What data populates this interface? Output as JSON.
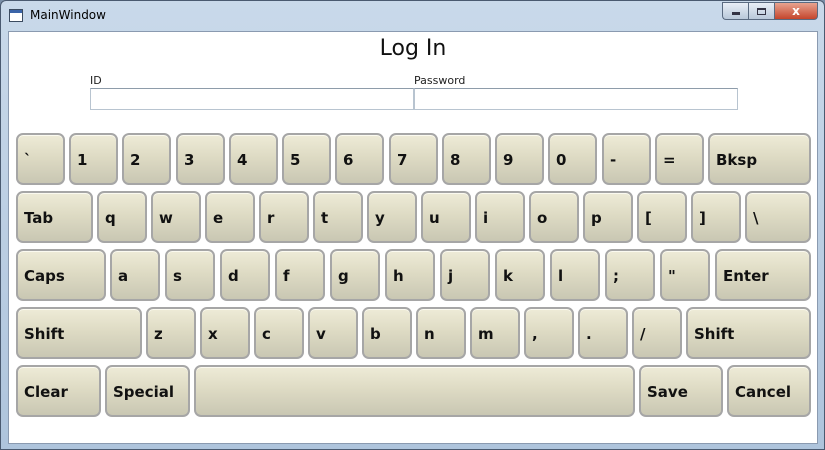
{
  "window": {
    "title": "MainWindow",
    "close_glyph": "x"
  },
  "heading": "Log In",
  "fields": {
    "id": {
      "label": "ID",
      "value": ""
    },
    "password": {
      "label": "Password",
      "value": ""
    }
  },
  "keyboard": {
    "row1": [
      "`",
      "1",
      "2",
      "3",
      "4",
      "5",
      "6",
      "7",
      "8",
      "9",
      "0",
      "-",
      "=",
      "Bksp"
    ],
    "row2": [
      "Tab",
      "q",
      "w",
      "e",
      "r",
      "t",
      "y",
      "u",
      "i",
      "o",
      "p",
      "[",
      "]",
      "\\"
    ],
    "row3": [
      "Caps",
      "a",
      "s",
      "d",
      "f",
      "g",
      "h",
      "j",
      "k",
      "l",
      ";",
      "\"",
      "Enter"
    ],
    "row4": [
      "Shift",
      "z",
      "x",
      "c",
      "v",
      "b",
      "n",
      "m",
      ",",
      ".",
      "/",
      "Shift"
    ],
    "row5": [
      "Clear",
      "Special",
      "",
      "Save",
      "Cancel"
    ]
  },
  "icons": {
    "app": "window-app-icon",
    "minimize": "minimize-icon",
    "maximize": "maximize-icon",
    "close": "close-icon"
  },
  "colors": {
    "key_face": "#dedbc4",
    "key_border": "#a6a6a6",
    "close_button": "#c5452c"
  }
}
